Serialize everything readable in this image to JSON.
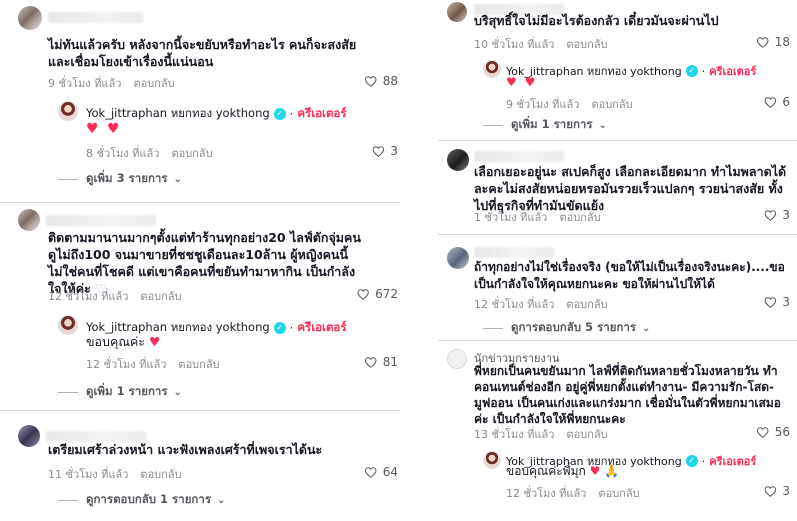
{
  "left": {
    "comments": [
      {
        "text": "ไม่ทันแล้วครับ หลังจากนี้จะขยับหรือทำอะไร คนก็จะสงสัยและเชื่อมโยงเข้าเรื่องนี้แน่นอน",
        "time": "9 ชั่วโมง ที่แล้ว",
        "reply": "ตอบกลับ",
        "likes": "88",
        "creator_reply": {
          "name": "Yok_jittraphan หยกทอง yokthong",
          "badge": "ครีเอเตอร์",
          "text": "♥ ♥",
          "time": "8 ชั่วโมง ที่แล้ว",
          "reply": "ตอบกลับ",
          "likes": "3"
        },
        "more": "ดูเพิ่ม 3 รายการ"
      },
      {
        "text": "ติดตามมานานมากๆตั้งแต่ทำร้านทุกอย่าง20 ไลฟ์ตักจุ่มคนดูไม่ถึง100 จนมาขายที่ชชชูเดือนละ10ล้าน ผู้หญิงคนนี้ไม่ใช่คนที่โชคดี แต่เขาคือคนที่ขยันทำมาหากิน เป็นกำลังใจให้ค่ะ",
        "emoji": "♡",
        "time": "12 ชั่วโมง ที่แล้ว",
        "reply": "ตอบกลับ",
        "likes": "672",
        "creator_reply": {
          "name": "Yok_jittraphan หยกทอง yokthong",
          "badge": "ครีเอเตอร์",
          "text": "ขอบคุณค่ะ",
          "heart": "♥",
          "time": "12 ชั่วโมง ที่แล้ว",
          "reply": "ตอบกลับ",
          "likes": "81"
        },
        "more": "ดูเพิ่ม 1 รายการ"
      },
      {
        "text": "เตรียมเศร้าล่วงหน้า แวะฟังเพลงเศร้าที่เพจเราได้นะ",
        "time": "11 ชั่วโมง ที่แล้ว",
        "reply": "ตอบกลับ",
        "likes": "64",
        "more": "ดูการตอบกลับ 1 รายการ"
      }
    ]
  },
  "right": {
    "comments": [
      {
        "text": "บริสุทธิ์ใจไม่มีอะไรต้องกลัว เดี๋ยวมันจะผ่านไป",
        "time": "10 ชั่วโมง ที่แล้ว",
        "reply": "ตอบกลับ",
        "likes": "18",
        "creator_reply": {
          "name": "Yok_jittraphan หยกทอง yokthong",
          "badge": "ครีเอเตอร์",
          "text": "♥ ♥",
          "time": "9 ชั่วโมง ที่แล้ว",
          "reply": "ตอบกลับ",
          "likes": "6"
        },
        "more": "ดูเพิ่ม 1 รายการ"
      },
      {
        "text": "เลือกเยอะอยู่นะ สเปคก็สูง เลือกละเอียดมาก ทำไมพลาดได้ละคะไม่สงสัยหน่อยหรอมันรวยเร็วแปลกๆ รวยน่าสงสัย ทั้งไปที่ธุรกิจที่ทำมันขัดแย้ง",
        "time": "1 ชั่วโมง ที่แล้ว",
        "reply": "ตอบกลับ",
        "likes": "3"
      },
      {
        "text": "ถ้าทุกอย่างไม่ใช่เรื่องจริง (ขอให้ไม่เป็นเรื่องจริงนะคะ)....ขอเป็นกำลังใจให้คุณหยกนะคะ ขอให้ผ่านไปให้ได้",
        "time": "12 ชั่วโมง ที่แล้ว",
        "reply": "ตอบกลับ",
        "likes": "3",
        "more": "ดูการตอบกลับ 5 รายการ"
      },
      {
        "username": "นักข่าวมุกรายงาน",
        "text": "พี่หยกเป็นคนขยันมาก ไลฟ์ที่ติดกันหลายชั่วโมงหลายวัน ทำคอนเทนต์ช่องอีก อยู่คู่พี่หยกตั้งแต่ทำงาน- มีความรัก-โสด-มูฟออน เป็นคนเก่งและแกร่งมาก เชื่อมั่นในตัวพี่หยกมาเสมอค่ะ เป็นกำลังใจให้พี่หยกนะคะ",
        "time": "13 ชั่วโมง ที่แล้ว",
        "reply": "ตอบกลับ",
        "likes": "56",
        "creator_reply": {
          "name": "Yok_jittraphan หยกทอง yokthong",
          "badge": "ครีเอเตอร์",
          "text": "ขอบคุณค่ะพี่มุก",
          "heart": "♥",
          "emoji": "🙏",
          "time": "12 ชั่วโมง ที่แล้ว",
          "reply": "ตอบกลับ",
          "likes": "3"
        }
      }
    ]
  },
  "colors": {
    "accent": "#fe2c55",
    "verified": "#20d5ec",
    "meta": "#8a8b91"
  }
}
